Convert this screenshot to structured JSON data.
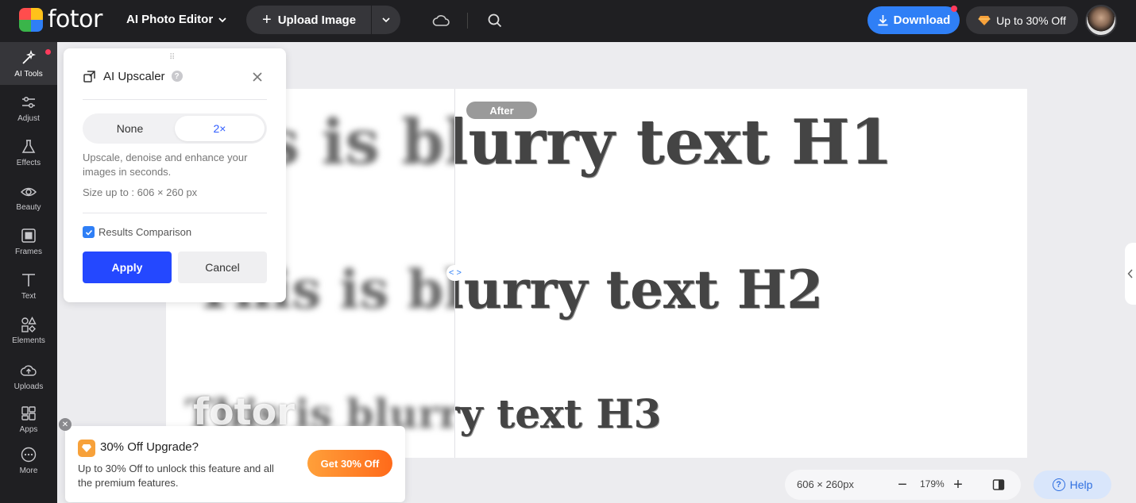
{
  "topbar": {
    "logo_text": "fotor",
    "editor_label": "AI Photo Editor",
    "upload_label": "Upload Image",
    "download_label": "Download",
    "promo_label": "Up to 30% Off"
  },
  "rail": {
    "items": [
      {
        "label": "AI Tools",
        "icon": "sparkle-wand-icon"
      },
      {
        "label": "Adjust",
        "icon": "sliders-icon"
      },
      {
        "label": "Effects",
        "icon": "flask-icon"
      },
      {
        "label": "Beauty",
        "icon": "eye-icon"
      },
      {
        "label": "Frames",
        "icon": "frame-icon"
      },
      {
        "label": "Text",
        "icon": "text-icon"
      },
      {
        "label": "Elements",
        "icon": "shapes-icon"
      },
      {
        "label": "Uploads",
        "icon": "cloud-upload-icon"
      },
      {
        "label": "Apps",
        "icon": "apps-icon"
      },
      {
        "label": "More",
        "icon": "more-icon"
      }
    ]
  },
  "panel": {
    "title": "AI Upscaler",
    "options": [
      "None",
      "2×"
    ],
    "selected_option": "2×",
    "description": "Upscale, denoise and enhance your images in seconds.",
    "size_text": "Size up to : 606 × 260 px",
    "comparison_label": "Results Comparison",
    "comparison_checked": true,
    "apply_label": "Apply",
    "cancel_label": "Cancel"
  },
  "canvas": {
    "after_label": "After",
    "watermark": "fotor",
    "lines": [
      "This is blurry text H1",
      "This is blurry text H2",
      "This is blurry text H3"
    ],
    "split_handle": "< >"
  },
  "toast": {
    "title": "30% Off Upgrade?",
    "text": "Up to 30% Off to unlock this feature and all the premium features.",
    "button_label": "Get 30% Off"
  },
  "bottom": {
    "dimensions": "606 × 260px",
    "zoom": "179%",
    "help_label": "Help"
  },
  "colors": {
    "accent": "#2f7ff6",
    "apply": "#2448ff",
    "promo_orange": "#ff7a22",
    "topbar": "#1f1f22"
  }
}
